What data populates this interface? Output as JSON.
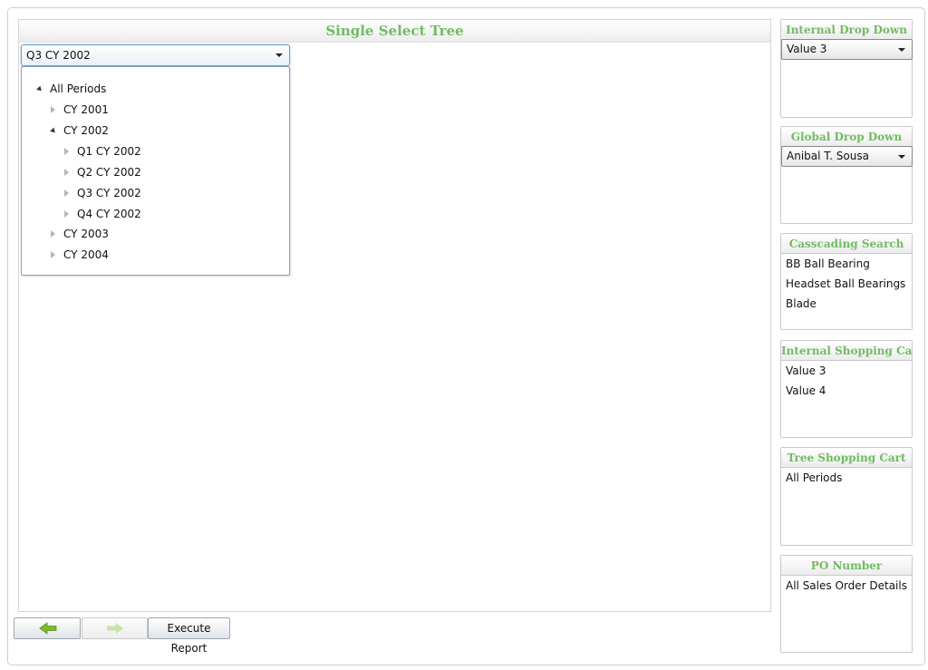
{
  "main": {
    "title": "Single Select Tree",
    "selected_value": "Q3 CY 2002",
    "tree": {
      "root": "All Periods",
      "cy2001": "CY 2001",
      "cy2002": "CY 2002",
      "q1": "Q1 CY 2002",
      "q2": "Q2 CY 2002",
      "q3": "Q3 CY 2002",
      "q4": "Q4 CY 2002",
      "cy2003": "CY 2003",
      "cy2004": "CY 2004"
    }
  },
  "toolbar": {
    "back_icon": "arrow-left-icon",
    "forward_icon": "arrow-right-icon",
    "execute_label": "Execute Report",
    "arrow_color": "#7dbb2a",
    "arrow_disabled_color": "#c8e2a6"
  },
  "sidebar": {
    "internal_drop_down": {
      "title": "Internal Drop Down",
      "value": "Value 3"
    },
    "global_drop_down": {
      "title": "Global Drop Down",
      "value": "Anibal T. Sousa"
    },
    "cascading_search": {
      "title": "Casscading Search",
      "items": [
        "BB Ball Bearing",
        "Headset Ball Bearings",
        "Blade"
      ]
    },
    "internal_shopping_cart": {
      "title": "Internal Shopping Cart",
      "items": [
        "Value 3",
        "Value 4"
      ]
    },
    "tree_shopping_cart": {
      "title": "Tree Shopping Cart",
      "items": [
        "All Periods"
      ]
    },
    "po_number": {
      "title": "PO Number",
      "items": [
        "All Sales Order Details"
      ]
    }
  },
  "colors": {
    "accent": "#72bb64",
    "combo_border": "#6d9bc6"
  }
}
